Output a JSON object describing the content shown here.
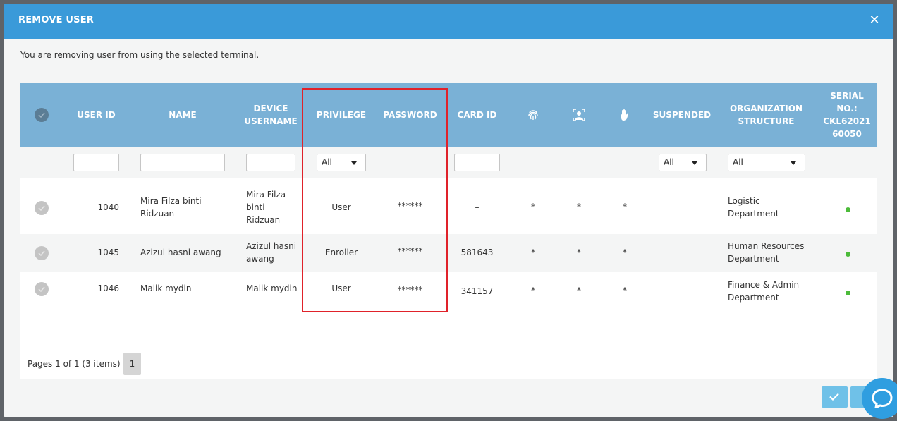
{
  "modal": {
    "title": "REMOVE USER",
    "close_label": "✕",
    "intro": "You are removing user from using the selected terminal."
  },
  "table": {
    "headers": {
      "user_id": "USER ID",
      "name": "NAME",
      "device_username": "DEVICE USERNAME",
      "privilege": "PRIVILEGE",
      "password": "PASSWORD",
      "card_id": "CARD ID",
      "fingerprint_icon": "fingerprint-icon",
      "face_icon": "face-scan-icon",
      "palm_icon": "palm-icon",
      "suspended": "SUSPENDED",
      "organization_structure": "ORGANIZATION STRUCTURE",
      "serial_line1": "SERIAL",
      "serial_line2": "NO.:",
      "serial_line3": "CKL62021",
      "serial_line4": "60050"
    },
    "filters": {
      "privilege": "All",
      "suspended": "All",
      "organization": "All"
    },
    "rows": [
      {
        "user_id": "1040",
        "name": "Mira Filza binti Ridzuan",
        "device_username": "Mira Filza binti Ridzuan",
        "privilege": "User",
        "password": "******",
        "card_id": "–",
        "fp": "*",
        "face": "*",
        "palm": "*",
        "suspended": "",
        "organization": "Logistic Department"
      },
      {
        "user_id": "1045",
        "name": "Azizul hasni awang",
        "device_username": "Azizul hasni awang",
        "privilege": "Enroller",
        "password": "******",
        "card_id": "581643",
        "fp": "*",
        "face": "*",
        "palm": "*",
        "suspended": "",
        "organization": "Human Resources Department"
      },
      {
        "user_id": "1046",
        "name": "Malik mydin",
        "device_username": "Malik mydin",
        "privilege": "User",
        "password": "******",
        "card_id": "341157",
        "fp": "*",
        "face": "*",
        "palm": "*",
        "suspended": "",
        "organization": "Finance & Admin Department"
      }
    ]
  },
  "pager": {
    "summary": "Pages 1 of 1 (3 items)",
    "current_page": "1"
  },
  "colors": {
    "header": "#3a9ad9",
    "table_header": "#7ab1d6",
    "online_dot": "#4cbb3a",
    "highlight": "#e0222a"
  }
}
